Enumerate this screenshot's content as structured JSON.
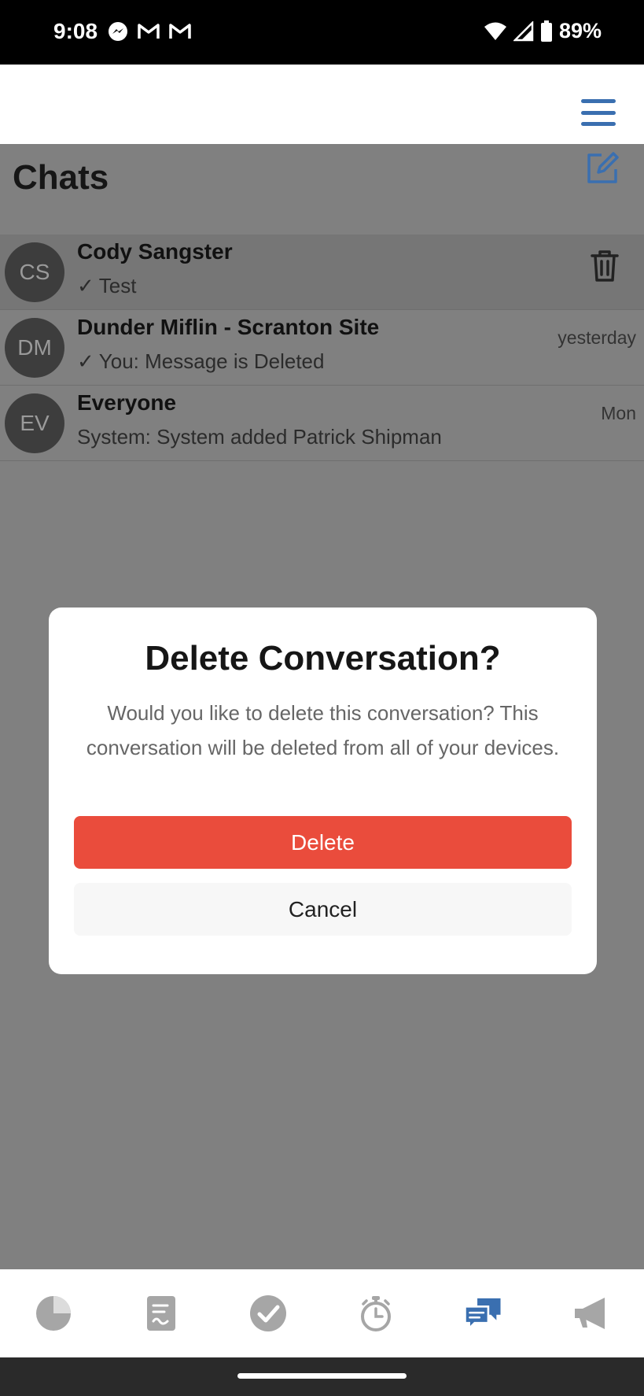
{
  "status_bar": {
    "time": "9:08",
    "battery": "89%",
    "icons_left": [
      "messenger-icon",
      "gmail-icon",
      "gmail-icon"
    ],
    "icons_right": [
      "wifi-icon",
      "signal-icon",
      "battery-icon"
    ]
  },
  "header": {
    "menu_icon": "hamburger-menu-icon"
  },
  "page": {
    "title": "Chats",
    "compose_icon": "compose-icon"
  },
  "chats": [
    {
      "initials": "CS",
      "name": "Cody Sangster",
      "preview": "Test",
      "read_check": true,
      "time": "",
      "selected": true
    },
    {
      "initials": "DM",
      "name": "Dunder Miflin - Scranton Site",
      "preview": "You: Message is Deleted",
      "read_check": true,
      "time": "yesterday",
      "selected": false
    },
    {
      "initials": "EV",
      "name": "Everyone",
      "preview": "System: System added Patrick Shipman",
      "read_check": false,
      "time": "Mon",
      "selected": false
    }
  ],
  "modal": {
    "title": "Delete Conversation?",
    "body": "Would you like to delete this conversation? This conversation will be deleted from all of your devices.",
    "delete_label": "Delete",
    "cancel_label": "Cancel"
  },
  "bottom_nav": [
    {
      "icon": "pie-chart-icon",
      "active": false
    },
    {
      "icon": "clipboard-icon",
      "active": false
    },
    {
      "icon": "checkmark-icon",
      "active": false
    },
    {
      "icon": "stopwatch-icon",
      "active": false
    },
    {
      "icon": "chat-bubbles-icon",
      "active": true
    },
    {
      "icon": "megaphone-icon",
      "active": false
    }
  ],
  "colors": {
    "accent": "#3a6fb0",
    "danger": "#ea4c3c",
    "overlay": "#808080",
    "nav_inactive": "#a6a6a6"
  }
}
